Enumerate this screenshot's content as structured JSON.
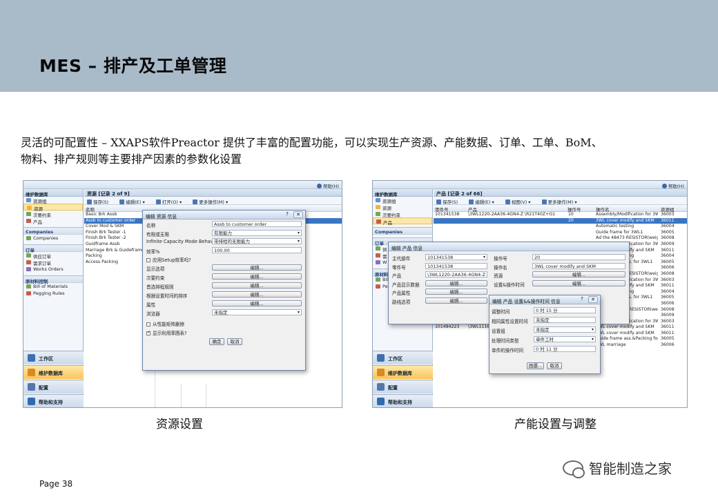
{
  "header": {
    "title": "MES – 排产及工单管理"
  },
  "intro": {
    "line1": "灵活的可配置性 – XXAPS软件Preactor 提供了丰富的配置功能，可以实现生产资源、产能数据、订单、工单、BoM、",
    "line2": "物料、排产规则等主要排产因素的参数化设置"
  },
  "left_shot": {
    "caption": "资源设置",
    "help": "帮助(H)",
    "nav": {
      "header": "维护数据库",
      "items": [
        "资源组",
        "资源",
        "次要约束",
        "产品"
      ],
      "selected_index": 1,
      "sections": [
        {
          "title": "Companies",
          "items": [
            "Companies"
          ]
        },
        {
          "title": "订单",
          "items": [
            "供应订单",
            "需求订单",
            "Works Orders"
          ]
        },
        {
          "title": "原材料控制",
          "items": [
            "Bill of Materials",
            "Pegging Rules"
          ]
        }
      ],
      "buttons": [
        "工作区",
        "维护数据库",
        "配置",
        "帮助和支持"
      ]
    },
    "main": {
      "title": "资源 [记录 2 of 9]",
      "toolbar": [
        "保存(S)",
        "编辑(E) ▾",
        "打开(O) ▾",
        "更多操作(M) ▾"
      ],
      "column": "名称",
      "rows": [
        "Basic Brk Assb",
        "Assb to customer order",
        "Cover Mod & SKM",
        "Finish Brk Tester -1",
        "Finish Brk Tester -2",
        "Guidframe Assb",
        "Marriage Brk & Guideframe",
        "Packing",
        "Access Packing"
      ],
      "selected_row": 1
    },
    "dialog": {
      "title": "编辑 资源 信息",
      "fields": [
        {
          "label": "名称",
          "value": "Assb to customer order",
          "kind": "text"
        },
        {
          "label": "有限或无限",
          "value": "有限能力",
          "kind": "select"
        },
        {
          "label": "Infinite Capacity Mode Behavior",
          "value": "带排程的无限能力",
          "kind": "select"
        },
        {
          "label": "效率%",
          "value": "100.00",
          "kind": "text"
        }
      ],
      "checkbox1": "应用Setup效率吗?",
      "edit_rows": [
        "显示选项",
        "次要约束",
        "首选排程规则",
        "根据设置时间的排序",
        "属性"
      ],
      "edit_label": "编辑...",
      "browser_label": "浏览器",
      "browser_value": "未指定",
      "checkbox2": "从性能矩阵删除",
      "checkbox3": "显示利用率图表?",
      "ok": "确定",
      "cancel": "取消"
    }
  },
  "right_shot": {
    "caption": "产能设置与调整",
    "help": "帮助(H)",
    "nav": {
      "header": "维护数据库",
      "items": [
        "资源组",
        "资源",
        "次要约束",
        "产品"
      ],
      "selected_index": 3,
      "sections": [
        {
          "title": "Companies",
          "items": []
        },
        {
          "title": "订单",
          "items": [
            "供",
            "需",
            "W"
          ]
        },
        {
          "title": "原材料控制",
          "items": [
            "Bill",
            "Pe"
          ]
        }
      ],
      "buttons": [
        "工作区",
        "维护数据库",
        "配置",
        "帮助和支持"
      ]
    },
    "main": {
      "title": "产品 [记录 2 of 66]",
      "toolbar": [
        "保存(S)",
        "编辑(E) ▾",
        "视图(V) ▾",
        "更多操作(M) ▾"
      ],
      "columns": [
        "零件号",
        "产品",
        "操作号",
        "操作名",
        "资源组"
      ],
      "part_a": "101341538",
      "product_a": "\\3WL1220-2AA36-4GN4-Z \\R21T40Z+G1",
      "part_b": "101484223",
      "product_b": "\\3WL1116",
      "rows": [
        {
          "op": "10",
          "name": "Assembly/Modification for 3WL1",
          "res": "36003"
        },
        {
          "op": "20",
          "name": "3WL cover modify and SKM",
          "res": "36011"
        },
        {
          "op": "",
          "name": "Automatic testing",
          "res": "36004"
        },
        {
          "op": "",
          "name": "Guide frame for 3WL1",
          "res": "36005"
        },
        {
          "op": "",
          "name": "Ad the 48473 RESISTOR(weigh",
          "res": "36008"
        },
        {
          "op": "",
          "name": "Assembly/Modification for 3WL1",
          "res": "36009"
        },
        {
          "op": "",
          "name": "3WL cover modify and SKM",
          "res": "36011"
        },
        {
          "op": "",
          "name": "Automatic testing",
          "res": "36004"
        },
        {
          "op": "",
          "name": "Guide frame ass. for 3WL1",
          "res": "36005"
        },
        {
          "op": "",
          "name": "3WL marriage",
          "res": "36006"
        },
        {
          "op": "",
          "name": "Ad the 48473 RESISTOR(weigh",
          "res": "36008"
        },
        {
          "op": "",
          "name": "Assembly/Modification for 3WL1",
          "res": "36003"
        },
        {
          "op": "",
          "name": "3WL cover modify and SKM",
          "res": "36011"
        },
        {
          "op": "",
          "name": "Automatic testing",
          "res": "36004"
        },
        {
          "op": "",
          "name": "Guide frame ass. for 3WL1",
          "res": "36005"
        },
        {
          "op": "",
          "name": "3WL marriage",
          "res": "36006"
        },
        {
          "op": "",
          "name": "Add the 48473 RESISTOR(weigh",
          "res": "36008"
        },
        {
          "op": "",
          "name": "Packing for 3WL",
          "res": "36009"
        },
        {
          "op": "",
          "name": "Assembly/Modification for 3WL1",
          "res": "36003"
        },
        {
          "op": "",
          "name": "3WL cover modify and SKM",
          "res": "36011"
        },
        {
          "op": "12",
          "name": "3WL cover modify and SKM",
          "res": "36011"
        },
        {
          "op": "13",
          "name": "Guide frame ass.&Packing for",
          "res": "36005"
        },
        {
          "op": "14",
          "name": "3WL marriage",
          "res": "36006"
        }
      ]
    },
    "dialog1": {
      "title": "编辑 产品 信息",
      "left": [
        {
          "label": "主代部件",
          "value": "101341538",
          "kind": "select"
        },
        {
          "label": "零件号",
          "value": "101341538",
          "kind": "text"
        },
        {
          "label": "产品",
          "value": "\\3WL1220-2AA36-4GN4-Z \\R21",
          "kind": "text"
        },
        {
          "label": "产品显示数据",
          "value": "编辑...",
          "kind": "button"
        },
        {
          "label": "产品属性",
          "value": "编辑...",
          "kind": "button"
        },
        {
          "label": "路线选项",
          "value": "编辑...",
          "kind": "button"
        }
      ],
      "right": [
        {
          "label": "操作号",
          "value": "20",
          "kind": "text"
        },
        {
          "label": "操作名",
          "value": "3WL cover modify and SKM",
          "kind": "text"
        },
        {
          "label": "资源",
          "value": "编辑...",
          "kind": "button"
        },
        {
          "label": "设置&操作时间",
          "value": "编辑...",
          "kind": "button"
        }
      ]
    },
    "dialog2": {
      "title": "编辑 产品 设置&&操作时间 信息",
      "fields": [
        {
          "label": "调整时间",
          "value": "0 时 15 分",
          "kind": "text"
        },
        {
          "label": "相同属性设置时间",
          "value": "未指定",
          "kind": "text"
        },
        {
          "label": "设置组",
          "value": "未指定",
          "kind": "select"
        },
        {
          "label": "处理时间类型",
          "value": "单件工时",
          "kind": "select"
        },
        {
          "label": "单件的操作时间",
          "value": "0 时 11 分",
          "kind": "text"
        }
      ],
      "ok": "困選...",
      "cancel": "取消"
    }
  },
  "footer": {
    "page": "Page 38",
    "watermark": "智能制造之家"
  }
}
